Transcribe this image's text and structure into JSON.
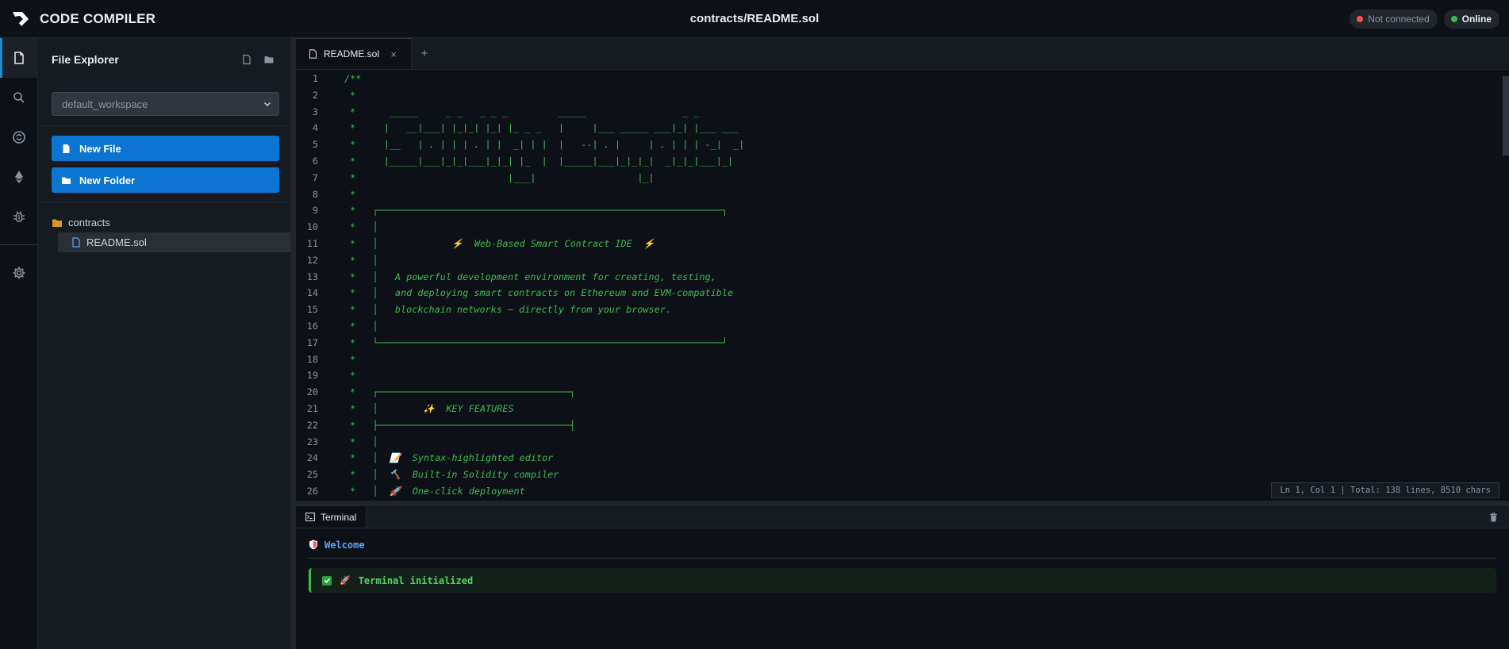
{
  "app": {
    "name": "CODE COMPILER",
    "title": "contracts/README.sol",
    "status_disconnected": "Not connected",
    "status_online": "Online"
  },
  "colors": {
    "accent": "#0b75d1",
    "disconnected_dot": "#f85149",
    "online_dot": "#3fb950",
    "comment": "#3fb950"
  },
  "activity_icons": [
    "file-icon",
    "search-icon",
    "compiler-icon",
    "ethereum-icon",
    "bug-icon",
    "gear-icon"
  ],
  "sidebar": {
    "title": "File Explorer",
    "workspace": "default_workspace",
    "new_file_label": "New File",
    "new_folder_label": "New Folder",
    "folder": "contracts",
    "file": "README.sol"
  },
  "editor": {
    "tab_label": "README.sol",
    "tab_close": "×",
    "tab_add": "+",
    "status": "Ln 1, Col 1 | Total: 138 lines, 8510 chars",
    "lines": [
      {
        "n": "1",
        "t": "/**"
      },
      {
        "n": "2",
        "t": " *"
      },
      {
        "n": "3",
        "t": " *      _____     _ _   _ _ _         _____                 _ _"
      },
      {
        "n": "4",
        "t": " *     |   __|___| |_|_| |_| |_ _ _   |     |___ _____ ___|_| |___ ___"
      },
      {
        "n": "5",
        "t": " *     |__   | . | | | . | |  _| | |  |   --| . |     | . | | | -_|  _|"
      },
      {
        "n": "6",
        "t": " *     |_____|___|_|_|___|_|_| |_  |  |_____|___|_|_|_|  _|_|_|___|_|"
      },
      {
        "n": "7",
        "t": " *                           |___|                  |_|"
      },
      {
        "n": "8",
        "t": " *"
      },
      {
        "n": "9",
        "t": " *   ┌─────────────────────────────────────────────────────────────┐"
      },
      {
        "n": "10",
        "t": " *   │"
      },
      {
        "n": "11",
        "t": " *   │             ⚡  Web-Based Smart Contract IDE  ⚡"
      },
      {
        "n": "12",
        "t": " *   │"
      },
      {
        "n": "13",
        "t": " *   │   A powerful development environment for creating, testing,"
      },
      {
        "n": "14",
        "t": " *   │   and deploying smart contracts on Ethereum and EVM-compatible"
      },
      {
        "n": "15",
        "t": " *   │   blockchain networks — directly from your browser."
      },
      {
        "n": "16",
        "t": " *   │"
      },
      {
        "n": "17",
        "t": " *   └─────────────────────────────────────────────────────────────┘"
      },
      {
        "n": "18",
        "t": " *"
      },
      {
        "n": "19",
        "t": " *"
      },
      {
        "n": "20",
        "t": " *   ┌──────────────────────────────────┐"
      },
      {
        "n": "21",
        "t": " *   │        ✨  KEY FEATURES"
      },
      {
        "n": "22",
        "t": " *   ├──────────────────────────────────┤"
      },
      {
        "n": "23",
        "t": " *   │"
      },
      {
        "n": "24",
        "t": " *   │  📝  Syntax-highlighted editor"
      },
      {
        "n": "25",
        "t": " *   │  🔨  Built-in Solidity compiler"
      },
      {
        "n": "26",
        "t": " *   │  🚀  One-click deployment"
      }
    ]
  },
  "terminal": {
    "tab_label": "Terminal",
    "welcome": "Welcome",
    "message": "Terminal initialized",
    "rocket": "🚀"
  }
}
